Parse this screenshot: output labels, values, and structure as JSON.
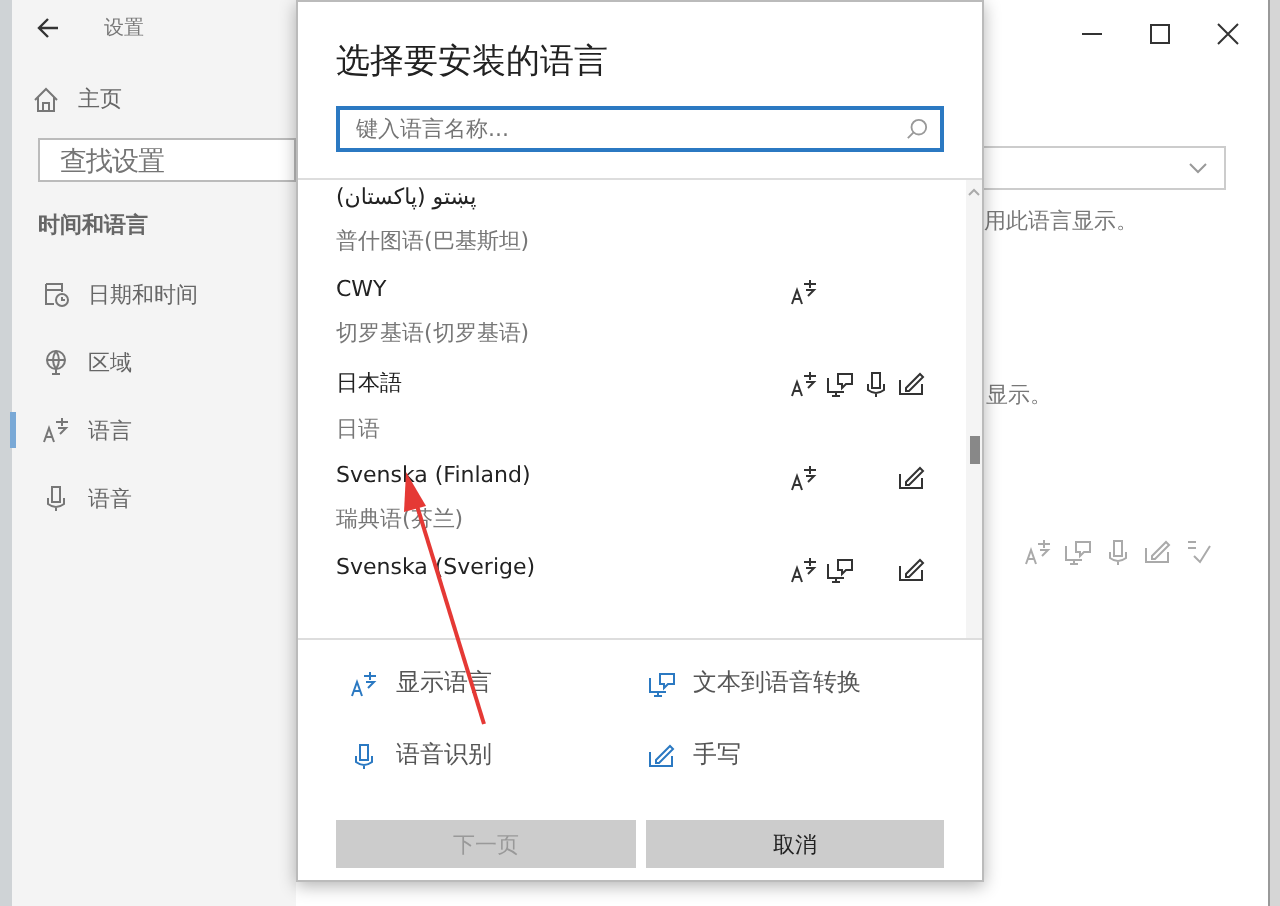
{
  "window": {
    "title": "设置"
  },
  "sidebar": {
    "home": "主页",
    "search_placeholder": "查找设置",
    "section": "时间和语言",
    "items": [
      {
        "kind": "calendar",
        "label": "日期和时间",
        "selected": false
      },
      {
        "kind": "globe",
        "label": "区域",
        "selected": false
      },
      {
        "kind": "display",
        "label": "语言",
        "selected": true
      },
      {
        "kind": "speech",
        "label": "语音",
        "selected": false
      }
    ]
  },
  "content": {
    "texts": [
      "用此语言显示。",
      "显示。"
    ],
    "features": [
      {
        "kind": "display"
      },
      {
        "kind": "tts"
      },
      {
        "kind": "speech"
      },
      {
        "kind": "handwriting"
      },
      {
        "kind": "spellcheck"
      }
    ]
  },
  "dialog": {
    "title": "选择要安装的语言",
    "search": {
      "placeholder": "键入语言名称..."
    },
    "languages": [
      {
        "name": "پښتو (پاکستان)",
        "translation": "普什图语(巴基斯坦)",
        "display": false,
        "tts": false,
        "speech": false,
        "handwriting": false
      },
      {
        "name": "CWY",
        "translation": "切罗基语(切罗基语)",
        "display": true,
        "tts": false,
        "speech": false,
        "handwriting": false
      },
      {
        "name": "日本語",
        "translation": "日语",
        "display": true,
        "tts": true,
        "speech": true,
        "handwriting": true
      },
      {
        "name": "Svenska (Finland)",
        "translation": "瑞典语(芬兰)",
        "display": true,
        "tts": false,
        "speech": false,
        "handwriting": true
      },
      {
        "name": "Svenska (Sverige)",
        "display": true,
        "tts": true,
        "speech": false,
        "handwriting": true
      }
    ],
    "legend": [
      {
        "kind": "display",
        "label": "显示语言"
      },
      {
        "kind": "tts",
        "label": "文本到语音转换"
      },
      {
        "kind": "speech",
        "label": "语音识别"
      },
      {
        "kind": "handwriting",
        "label": "手写"
      }
    ],
    "buttons": [
      {
        "label": "下一页",
        "disabled": true
      },
      {
        "label": "取消",
        "disabled": false
      }
    ]
  }
}
